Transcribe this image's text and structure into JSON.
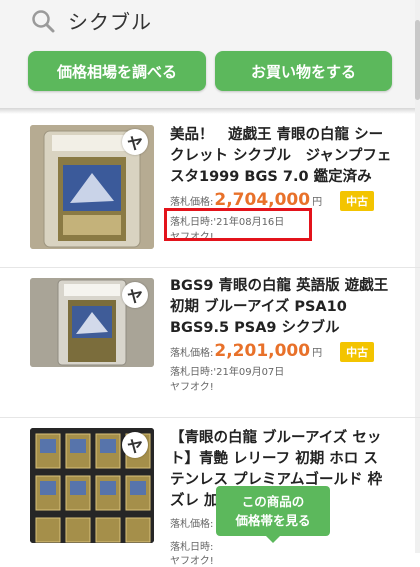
{
  "search": {
    "query": "シクブル"
  },
  "buttons": {
    "price_check": "価格相場を調べる",
    "shop": "お買い物をする"
  },
  "items": [
    {
      "title": "美品！　遊戯王 青眼の白龍 シークレット シクブル　ジャンプフェスタ1999 BGS 7.0 鑑定済み",
      "price_label": "落札価格:",
      "price": "2,704,000",
      "unit": "円",
      "condition": "中古",
      "date": "落札日時:'21年08月16日",
      "source": "ヤフオク!",
      "bookmark_glyph": "ヤ"
    },
    {
      "title": "BGS9 青眼の白龍 英語版 遊戯王 初期 ブルーアイズ PSA10 BGS9.5 PSA9 シクブル",
      "price_label": "落札価格:",
      "price": "2,201,000",
      "unit": "円",
      "condition": "中古",
      "date": "落札日時:'21年09月07日",
      "source": "ヤフオク!",
      "bookmark_glyph": "ヤ"
    },
    {
      "title": "【青眼の白龍 ブルーアイズ セット】青艶 レリーフ 初期 ホロ ステンレス プレミアムゴールド 枠ズレ 加工 シクブル 激…",
      "price_label": "落札価格:",
      "price": "",
      "unit": "",
      "condition": "",
      "date": "落札日時:",
      "source": "ヤフオク!",
      "bookmark_glyph": "ヤ"
    }
  ],
  "tooltip": {
    "line1": "この商品の",
    "line2": "価格帯を見る"
  },
  "colors": {
    "accent": "#5cb85c",
    "price": "#e8712a",
    "badge": "#f3c400",
    "highlight": "#e3131b"
  }
}
